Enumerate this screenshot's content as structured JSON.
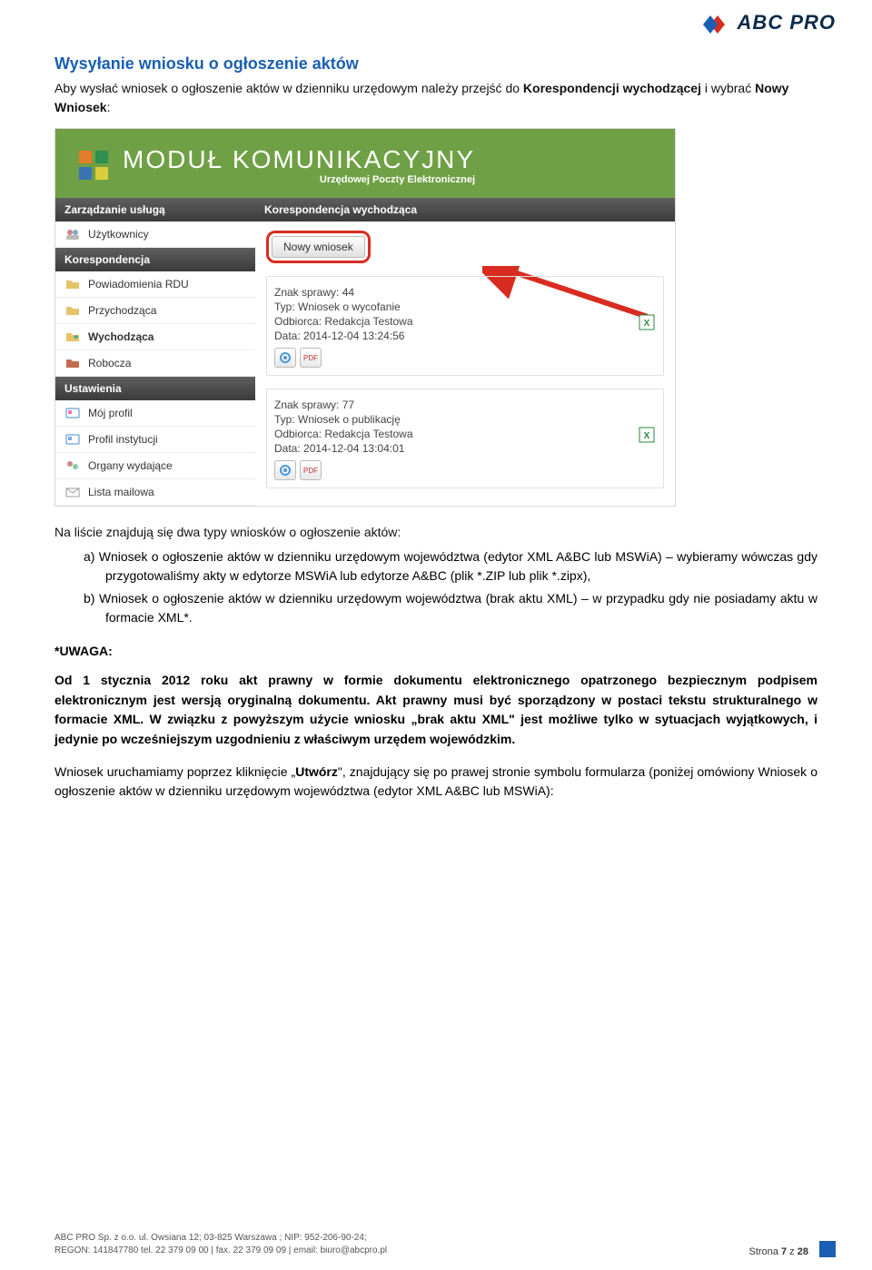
{
  "brand": {
    "name": "ABC PRO"
  },
  "section_title": "Wysyłanie wniosku o ogłoszenie aktów",
  "intro": {
    "pre": "Aby wysłać wniosek o ogłoszenie aktów w dzienniku urzędowym należy przejść do ",
    "bold1": "Korespondencji wychodzącej",
    "mid": " i wybrać ",
    "bold2": "Nowy Wniosek",
    "end": ":"
  },
  "module": {
    "title": "MODUŁ KOMUNIKACYJNY",
    "subtitle": "Urzędowej Poczty Elektronicznej",
    "sidebar_sections": [
      {
        "header": "Zarządzanie usługą",
        "items": [
          {
            "label": "Użytkownicy",
            "icon": "users-icon",
            "bold": false
          }
        ]
      },
      {
        "header": "Korespondencja",
        "items": [
          {
            "label": "Powiadomienia RDU",
            "icon": "folder-icon",
            "bold": false
          },
          {
            "label": "Przychodząca",
            "icon": "folder-icon",
            "bold": false
          },
          {
            "label": "Wychodząca",
            "icon": "folder-out-icon",
            "bold": true
          },
          {
            "label": "Robocza",
            "icon": "folder-red-icon",
            "bold": false
          }
        ]
      },
      {
        "header": "Ustawienia",
        "items": [
          {
            "label": "Mój profil",
            "icon": "id-icon",
            "bold": false
          },
          {
            "label": "Profil instytucji",
            "icon": "id-icon",
            "bold": false
          },
          {
            "label": "Organy wydające",
            "icon": "org-icon",
            "bold": false
          },
          {
            "label": "Lista mailowa",
            "icon": "mail-icon",
            "bold": false
          }
        ]
      }
    ],
    "crumb": "Korespondencja wychodząca",
    "new_button": "Nowy wniosek",
    "cases": [
      {
        "znak_label": "Znak sprawy: ",
        "znak": "44",
        "typ_label": "Typ: ",
        "typ": "Wniosek o wycofanie",
        "odb_label": "Odbiorca: ",
        "odb": "Redakcja Testowa",
        "data_label": "Data: ",
        "data": "2014-12-04 13:24:56"
      },
      {
        "znak_label": "Znak sprawy: ",
        "znak": "77",
        "typ_label": "Typ: ",
        "typ": "Wniosek o publikację",
        "odb_label": "Odbiorca: ",
        "odb": "Redakcja Testowa",
        "data_label": "Data: ",
        "data": "2014-12-04 13:04:01"
      }
    ],
    "mini_btn_labels": {
      "xml": "XML",
      "pdf": "PDF"
    }
  },
  "after_shot": "Na liście znajdują się dwa typy wniosków o ogłoszenie aktów:",
  "list": {
    "a": "a) Wniosek o ogłoszenie aktów w dzienniku urzędowym województwa (edytor XML A&BC lub MSWiA) – wybieramy wówczas gdy przygotowaliśmy akty w edytorze MSWiA lub edytorze A&BC (plik *.ZIP lub plik *.zipx),",
    "b": "b) Wniosek o ogłoszenie aktów w dzienniku  urzędowym województwa (brak aktu XML) – w przypadku gdy nie posiadamy aktu w formacie XML*."
  },
  "uwaga_label": "*UWAGA:",
  "uwaga_body": "Od 1 stycznia 2012 roku akt prawny w formie dokumentu elektronicznego opatrzonego bezpiecznym podpisem elektronicznym jest wersją oryginalną dokumentu. Akt prawny musi być sporządzony w postaci tekstu strukturalnego w formacie XML. W związku z powyższym użycie wniosku „brak aktu XML\" jest możliwe tylko w sytuacjach wyjątkowych, i jedynie po wcześniejszym uzgodnieniu z właściwym urzędem wojewódzkim.",
  "after2_pre": "Wniosek uruchamiamy poprzez kliknięcie „",
  "after2_bold": "Utwórz",
  "after2_post": "\", znajdujący się po prawej stronie symbolu formularza (poniżej omówiony Wniosek o ogłoszenie aktów w dzienniku urzędowym województwa (edytor XML A&BC lub MSWiA):",
  "footer": {
    "line1": "ABC PRO Sp. z o.o. ul. Owsiana 12;  03-825 Warszawa ; NIP: 952-206-90-24;",
    "line2": "REGON: 141847780 tel. 22 379 09 00 | fax. 22 379 09 09 | email: biuro@abcpro.pl",
    "page_pre": "Strona ",
    "page_no": "7",
    "page_mid": " z ",
    "page_total": "28"
  }
}
